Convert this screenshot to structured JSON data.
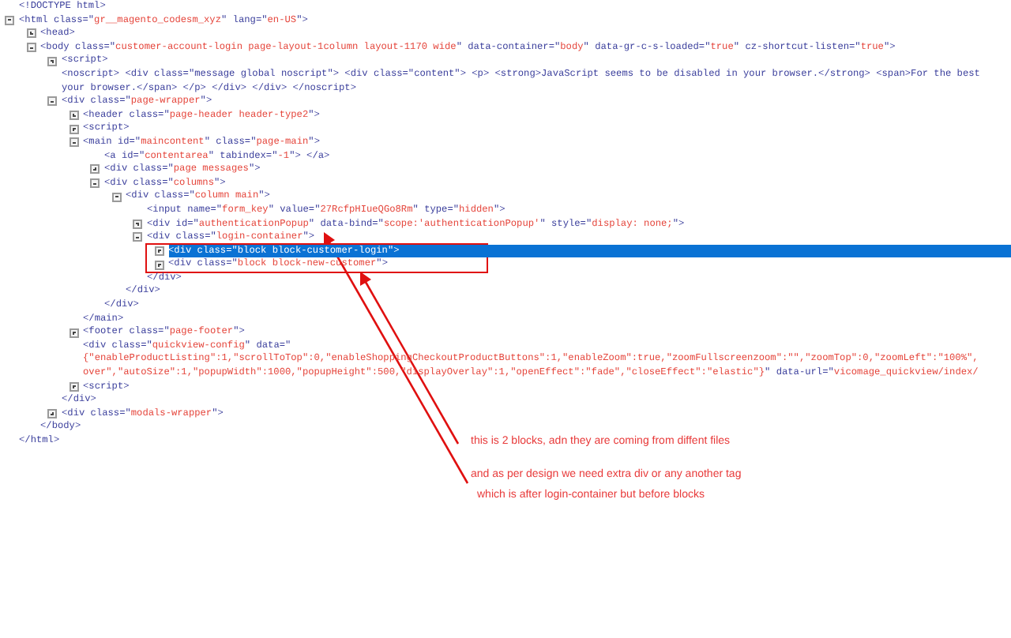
{
  "doctype": "<!DOCTYPE html>",
  "tree": [
    {
      "expanded": true,
      "selected": false,
      "parts": [
        {
          "kind": "markup",
          "text": "<html class=\""
        },
        {
          "kind": "value",
          "text": "gr__magento_codesm_xyz"
        },
        {
          "kind": "markup",
          "text": "\" lang=\""
        },
        {
          "kind": "value",
          "text": "en-US"
        },
        {
          "kind": "markup",
          "text": "\">"
        }
      ],
      "close": "</html>",
      "children": [
        {
          "expanded": false,
          "selected": false,
          "parts": [
            {
              "kind": "markup",
              "text": "<head>"
            }
          ]
        },
        {
          "expanded": true,
          "selected": false,
          "parts": [
            {
              "kind": "markup",
              "text": "<body class=\""
            },
            {
              "kind": "value",
              "text": "customer-account-login page-layout-1column layout-1170 wide"
            },
            {
              "kind": "markup",
              "text": "\" data-container=\""
            },
            {
              "kind": "value",
              "text": "body"
            },
            {
              "kind": "markup",
              "text": "\" data-gr-c-s-loaded=\""
            },
            {
              "kind": "value",
              "text": "true"
            },
            {
              "kind": "markup",
              "text": "\" cz-shortcut-listen=\""
            },
            {
              "kind": "value",
              "text": "true"
            },
            {
              "kind": "markup",
              "text": "\">"
            }
          ],
          "close": "</body>",
          "children": [
            {
              "expanded": false,
              "selected": false,
              "parts": [
                {
                  "kind": "markup",
                  "text": "<script>"
                }
              ]
            },
            {
              "selected": false,
              "parts": [
                {
                  "kind": "markup",
                  "text": "<noscript> <div class=\"message global noscript\"> <div class=\"content\"> <p> <strong>JavaScript seems to be disabled in your browser.</strong> <span>For the best"
                }
              ]
            },
            {
              "selected": false,
              "parts": [
                {
                  "kind": "markup",
                  "text": "your browser.</span> </p> </div> </div> </noscript>"
                }
              ]
            },
            {
              "expanded": true,
              "selected": false,
              "parts": [
                {
                  "kind": "markup",
                  "text": "<div class=\""
                },
                {
                  "kind": "value",
                  "text": "page-wrapper"
                },
                {
                  "kind": "markup",
                  "text": "\">"
                }
              ],
              "close": "</div>",
              "children": [
                {
                  "expanded": false,
                  "selected": false,
                  "parts": [
                    {
                      "kind": "markup",
                      "text": "<header class=\""
                    },
                    {
                      "kind": "value",
                      "text": "page-header header-type2"
                    },
                    {
                      "kind": "markup",
                      "text": "\">"
                    }
                  ]
                },
                {
                  "expanded": false,
                  "selected": false,
                  "parts": [
                    {
                      "kind": "markup",
                      "text": "<script>"
                    }
                  ]
                },
                {
                  "expanded": true,
                  "selected": false,
                  "parts": [
                    {
                      "kind": "markup",
                      "text": "<main id=\""
                    },
                    {
                      "kind": "value",
                      "text": "maincontent"
                    },
                    {
                      "kind": "markup",
                      "text": "\" class=\""
                    },
                    {
                      "kind": "value",
                      "text": "page-main"
                    },
                    {
                      "kind": "markup",
                      "text": "\">"
                    }
                  ],
                  "close": "</main>",
                  "children": [
                    {
                      "selected": false,
                      "parts": [
                        {
                          "kind": "markup",
                          "text": "<a id=\""
                        },
                        {
                          "kind": "value",
                          "text": "contentarea"
                        },
                        {
                          "kind": "markup",
                          "text": "\" tabindex=\""
                        },
                        {
                          "kind": "value",
                          "text": "-1"
                        },
                        {
                          "kind": "markup",
                          "text": "\"> </a>"
                        }
                      ]
                    },
                    {
                      "expanded": false,
                      "selected": false,
                      "parts": [
                        {
                          "kind": "markup",
                          "text": "<div class=\""
                        },
                        {
                          "kind": "value",
                          "text": "page messages"
                        },
                        {
                          "kind": "markup",
                          "text": "\">"
                        }
                      ]
                    },
                    {
                      "expanded": true,
                      "selected": false,
                      "parts": [
                        {
                          "kind": "markup",
                          "text": "<div class=\""
                        },
                        {
                          "kind": "value",
                          "text": "columns"
                        },
                        {
                          "kind": "markup",
                          "text": "\">"
                        }
                      ],
                      "close": "</div>",
                      "children": [
                        {
                          "expanded": true,
                          "selected": false,
                          "parts": [
                            {
                              "kind": "markup",
                              "text": "<div class=\""
                            },
                            {
                              "kind": "value",
                              "text": "column main"
                            },
                            {
                              "kind": "markup",
                              "text": "\">"
                            }
                          ],
                          "close": "</div>",
                          "children": [
                            {
                              "selected": false,
                              "parts": [
                                {
                                  "kind": "markup",
                                  "text": "<input name=\""
                                },
                                {
                                  "kind": "value",
                                  "text": "form_key"
                                },
                                {
                                  "kind": "markup",
                                  "text": "\" value=\""
                                },
                                {
                                  "kind": "value",
                                  "text": "27RcfpHIueQGo8Rm"
                                },
                                {
                                  "kind": "markup",
                                  "text": "\" type=\""
                                },
                                {
                                  "kind": "value",
                                  "text": "hidden"
                                },
                                {
                                  "kind": "markup",
                                  "text": "\">"
                                }
                              ]
                            },
                            {
                              "expanded": false,
                              "selected": false,
                              "parts": [
                                {
                                  "kind": "markup",
                                  "text": "<div id=\""
                                },
                                {
                                  "kind": "value",
                                  "text": "authenticationPopup"
                                },
                                {
                                  "kind": "markup",
                                  "text": "\" data-bind=\""
                                },
                                {
                                  "kind": "value",
                                  "text": "scope:'authenticationPopup'"
                                },
                                {
                                  "kind": "markup",
                                  "text": "\" style=\""
                                },
                                {
                                  "kind": "value",
                                  "text": "display: none;"
                                },
                                {
                                  "kind": "markup",
                                  "text": "\">"
                                }
                              ]
                            },
                            {
                              "expanded": true,
                              "selected": false,
                              "parts": [
                                {
                                  "kind": "markup",
                                  "text": "<div class=\""
                                },
                                {
                                  "kind": "value",
                                  "text": "login-container"
                                },
                                {
                                  "kind": "markup",
                                  "text": "\">"
                                }
                              ],
                              "close": "</div>",
                              "children": [
                                {
                                  "expanded": false,
                                  "selected": true,
                                  "parts": [
                                    {
                                      "kind": "markup",
                                      "text": "<div class=\""
                                    },
                                    {
                                      "kind": "value",
                                      "text": "block block-customer-login"
                                    },
                                    {
                                      "kind": "markup",
                                      "text": "\">"
                                    }
                                  ]
                                },
                                {
                                  "expanded": false,
                                  "selected": false,
                                  "parts": [
                                    {
                                      "kind": "markup",
                                      "text": "<div class=\""
                                    },
                                    {
                                      "kind": "value",
                                      "text": "block block-new-customer"
                                    },
                                    {
                                      "kind": "markup",
                                      "text": "\">"
                                    }
                                  ]
                                }
                              ]
                            }
                          ]
                        }
                      ]
                    }
                  ]
                },
                {
                  "expanded": false,
                  "selected": false,
                  "parts": [
                    {
                      "kind": "markup",
                      "text": "<footer class=\""
                    },
                    {
                      "kind": "value",
                      "text": "page-footer"
                    },
                    {
                      "kind": "markup",
                      "text": "\">"
                    }
                  ]
                },
                {
                  "selected": false,
                  "parts": [
                    {
                      "kind": "markup",
                      "text": "<div class=\""
                    },
                    {
                      "kind": "value",
                      "text": "quickview-config"
                    },
                    {
                      "kind": "markup",
                      "text": "\" data=\""
                    }
                  ]
                },
                {
                  "selected": false,
                  "parts": [
                    {
                      "kind": "value",
                      "text": "{\"enableProductListing\":1,\"scrollToTop\":0,\"enableShoppingCheckoutProductButtons\":1,\"enableZoom\":true,\"zoomFullscreenzoom\":\"\",\"zoomTop\":0,\"zoomLeft\":\"100%\","
                    }
                  ]
                },
                {
                  "selected": false,
                  "parts": [
                    {
                      "kind": "value",
                      "text": "over\",\"autoSize\":1,\"popupWidth\":1000,\"popupHeight\":500,\"displayOverlay\":1,\"openEffect\":\"fade\",\"closeEffect\":\"elastic\"}"
                    },
                    {
                      "kind": "markup",
                      "text": "\" data-url=\""
                    },
                    {
                      "kind": "value",
                      "text": "vicomage_quickview/index/"
                    }
                  ]
                },
                {
                  "expanded": false,
                  "selected": false,
                  "parts": [
                    {
                      "kind": "markup",
                      "text": "<script>"
                    }
                  ]
                }
              ]
            },
            {
              "expanded": false,
              "selected": false,
              "parts": [
                {
                  "kind": "markup",
                  "text": "<div class=\""
                },
                {
                  "kind": "value",
                  "text": "modals-wrapper"
                },
                {
                  "kind": "markup",
                  "text": "\">"
                }
              ]
            }
          ]
        }
      ]
    }
  ],
  "annotation": {
    "notes": [
      "this is 2 blocks, adn they are coming from diffent files",
      "and as per design we need extra div or any another tag",
      "which is after login-container but before blocks"
    ]
  }
}
